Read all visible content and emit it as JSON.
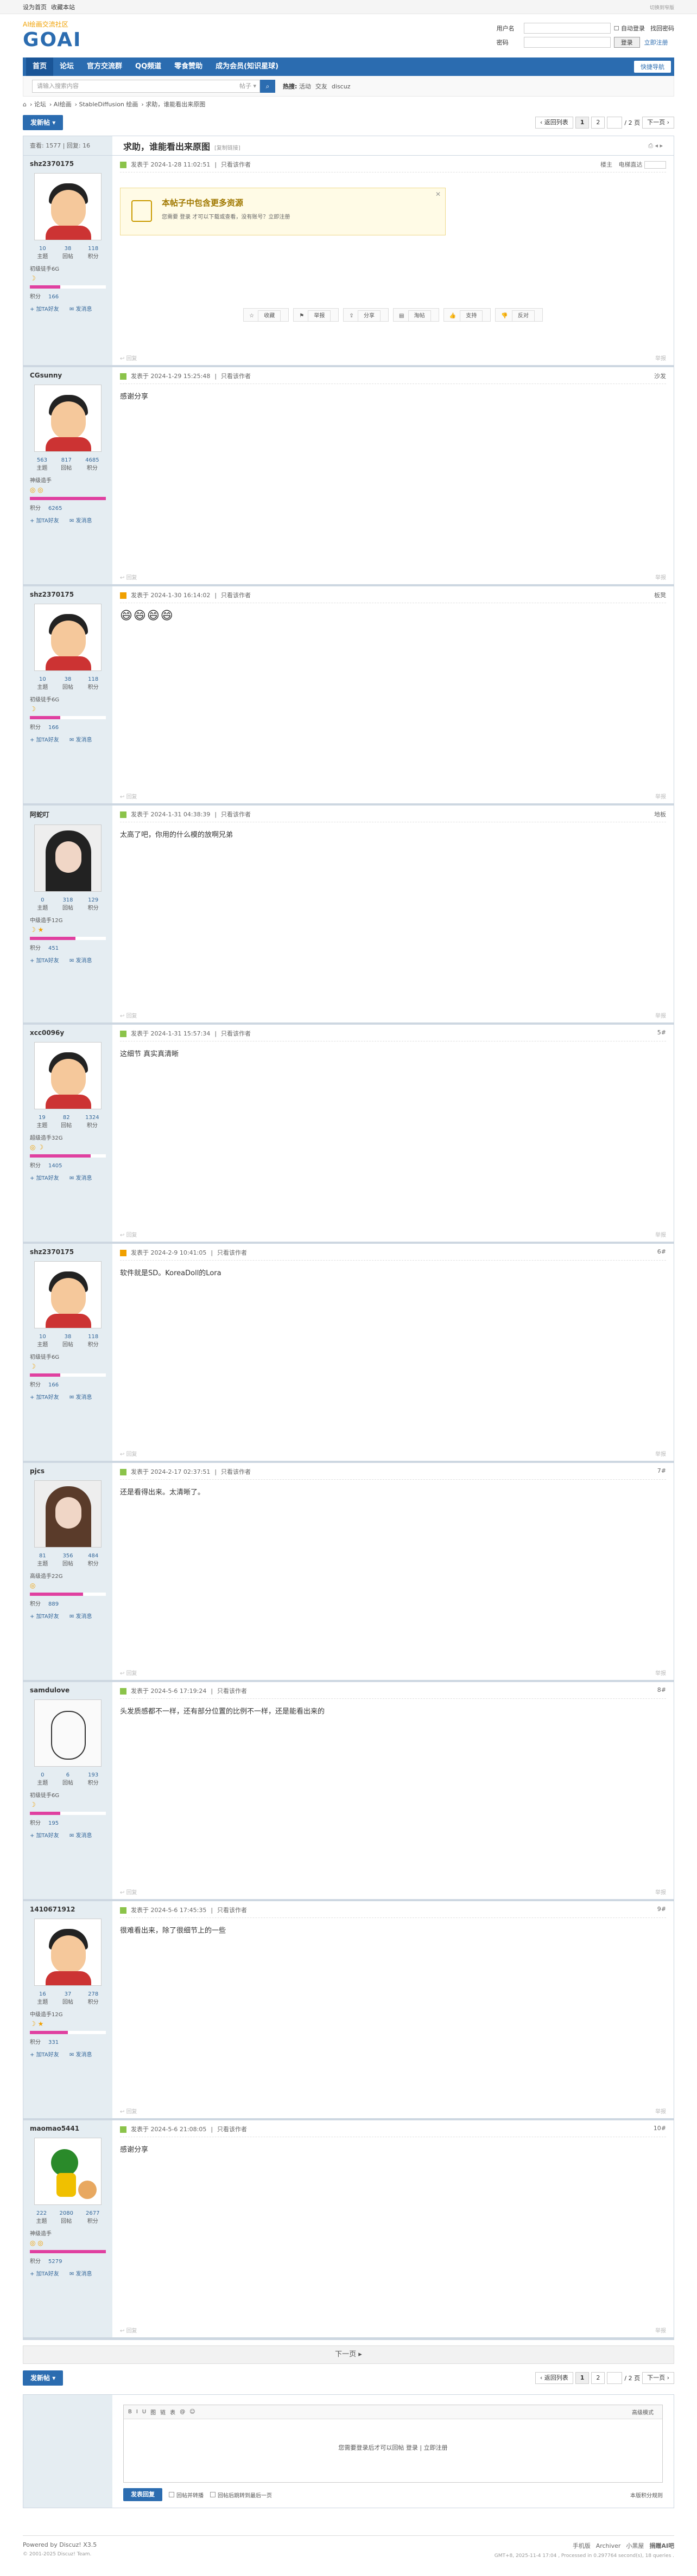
{
  "topbar": {
    "left": [
      "设为首页",
      "收藏本站"
    ],
    "right": "切换到窄版"
  },
  "header": {
    "logo_tag": "AI绘画交流社区",
    "logo_text": "GOAI",
    "login": {
      "user_label": "用户名",
      "pass_label": "密码",
      "auto": "自动登录",
      "forgot": "找回密码",
      "login_btn": "登录",
      "register": "立即注册"
    }
  },
  "nav": {
    "items": [
      "首页",
      "论坛",
      "官方交流群",
      "QQ频道",
      "零食赞助",
      "成为会员(知识星球)"
    ],
    "quick": "快捷导航"
  },
  "search": {
    "placeholder": "请输入搜索内容",
    "scope": "帖子",
    "hot_label": "热搜:",
    "hot": [
      "活动",
      "交友",
      "discuz"
    ]
  },
  "breadcrumb": [
    "论坛",
    "AI绘画",
    "StableDiffusion 绘画",
    "求助，谁能看出来原图"
  ],
  "pager": {
    "new_btn": "发新帖",
    "back": "返回列表",
    "pages": [
      "1",
      "2"
    ],
    "total": "/ 2 页",
    "next": "下一页"
  },
  "thread": {
    "views": "查看: 1577",
    "replies": "回复: 16",
    "title": "求助，谁能看出来原图",
    "copy": "[复制链接]",
    "tools": [
      "打印",
      "上一主题",
      "下一主题"
    ]
  },
  "posts": [
    {
      "user": "shz2370175",
      "avatar": "boy",
      "topic": "10",
      "reply": "38",
      "points_n": "118",
      "group": "初级徒手6G",
      "stars": "☽",
      "bar": 0.4,
      "points": "166",
      "meta": "发表于 2024-1-28 11:02:51",
      "author": "只看该作者",
      "floor": "楼主",
      "floor_extra": "电梯直达",
      "body": "",
      "first": true
    },
    {
      "user": "CGsunny",
      "avatar": "boy",
      "topic": "563",
      "reply": "817",
      "points_n": "4685",
      "group": "神级造手",
      "stars": "◎ ◎",
      "bar": 1.0,
      "points": "6265",
      "meta": "发表于 2024-1-29 15:25:48",
      "author": "只看该作者",
      "floor": "沙发",
      "body": "感谢分享"
    },
    {
      "user": "shz2370175",
      "avatar": "boy",
      "host": true,
      "topic": "10",
      "reply": "38",
      "points_n": "118",
      "group": "初级徒手6G",
      "stars": "☽",
      "bar": 0.4,
      "points": "166",
      "meta": "发表于 2024-1-30 16:14:02",
      "author": "只看该作者",
      "floor": "板凳",
      "body": "😄😄😄😄"
    },
    {
      "user": "阿蛇叮",
      "avatar": "girl",
      "topic": "0",
      "reply": "318",
      "points_n": "129",
      "group": "中级造手12G",
      "stars": "☽ ★",
      "bar": 0.6,
      "points": "451",
      "meta": "发表于 2024-1-31 04:38:39",
      "author": "只看该作者",
      "floor": "地板",
      "body": "太高了吧，你用的什么模的放啊兄弟"
    },
    {
      "user": "xcc0096y",
      "avatar": "boy",
      "topic": "19",
      "reply": "82",
      "points_n": "1324",
      "group": "超级造手32G",
      "stars": "◎ ☽",
      "bar": 0.8,
      "points": "1405",
      "meta": "发表于 2024-1-31 15:57:34",
      "author": "只看该作者",
      "floor": "5#",
      "body": "这细节 真实真清晰"
    },
    {
      "user": "shz2370175",
      "avatar": "boy",
      "host": true,
      "topic": "10",
      "reply": "38",
      "points_n": "118",
      "group": "初级徒手6G",
      "stars": "☽",
      "bar": 0.4,
      "points": "166",
      "meta": "发表于 2024-2-9 10:41:05",
      "author": "只看该作者",
      "floor": "6#",
      "body": "软件就是SD。KoreaDoll的Lora"
    },
    {
      "user": "pjcs",
      "avatar": "girl2",
      "topic": "81",
      "reply": "356",
      "points_n": "484",
      "group": "高级造手22G",
      "stars": "◎",
      "bar": 0.7,
      "points": "889",
      "meta": "发表于 2024-2-17 02:37:51",
      "author": "只看该作者",
      "floor": "7#",
      "body": "还是看得出来。太清晰了。"
    },
    {
      "user": "samdulove",
      "avatar": "sketch",
      "topic": "0",
      "reply": "6",
      "points_n": "193",
      "group": "初级徒手6G",
      "stars": "☽",
      "bar": 0.4,
      "points": "195",
      "meta": "发表于 2024-5-6 17:19:24",
      "author": "只看该作者",
      "floor": "8#",
      "body": "头发质感都不一样，还有部分位置的比例不一样，还是能看出来的"
    },
    {
      "user": "1410671912",
      "avatar": "boy",
      "topic": "16",
      "reply": "37",
      "points_n": "278",
      "group": "中级造手12G",
      "stars": "☽ ★",
      "bar": 0.5,
      "points": "331",
      "meta": "发表于 2024-5-6 17:45:35",
      "author": "只看该作者",
      "floor": "9#",
      "body": "很难看出来，除了很细节上的一些"
    },
    {
      "user": "maomao5441",
      "avatar": "toy",
      "topic": "222",
      "reply": "2080",
      "points_n": "2677",
      "group": "神级造手",
      "stars": "◎ ◎",
      "bar": 1.0,
      "points": "5279",
      "meta": "发表于 2024-5-6 21:08:05",
      "author": "只看该作者",
      "floor": "10#",
      "body": "感谢分享"
    }
  ],
  "labels": {
    "topic": "主题",
    "reply": "回帖",
    "points_n": "积分",
    "points": "积分",
    "send_msg": "发消息",
    "add_friend": "加TA好友",
    "reply_btn": "回复",
    "report": "举报",
    "quote": "快速回复"
  },
  "notice": {
    "title": "本帖子中包含更多资源",
    "text": "您需要 登录 才可以下载或查看，没有账号？立即注册"
  },
  "post_tools": [
    "收藏",
    "举报",
    "分享",
    "淘帖",
    "支持",
    "反对"
  ],
  "nextbar": "下一页",
  "reply_box": {
    "tools": [
      "B",
      "I",
      "U",
      "图",
      "链",
      "表",
      "@",
      "☺"
    ],
    "adv": "高级模式",
    "msg": "您需要登录后才可以回帖 登录 | 立即注册",
    "submit": "发表回复",
    "opt1": "回帖并转播",
    "opt2": "回帖后跳转到最后一页",
    "rt": "本版积分规则"
  },
  "footer": {
    "powered": "Powered by Discuz! X3.5",
    "copy": "© 2001-2025 Discuz! Team.",
    "links": [
      "手机版",
      "Archiver",
      "小黑屋",
      "捐赠AI吧"
    ],
    "stat": "GMT+8, 2025-11-4 17:04 , Processed in 0.297764 second(s), 18 queries ."
  }
}
